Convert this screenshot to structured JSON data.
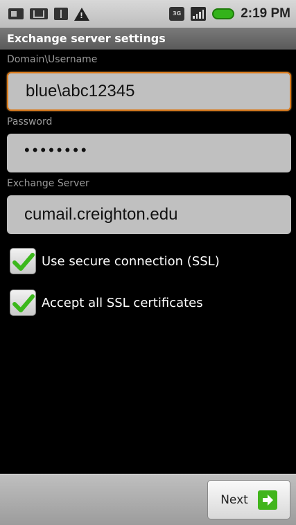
{
  "status_bar": {
    "time": "2:19 PM",
    "network_label": "3G",
    "icons": [
      "sim-icon",
      "mail-icon",
      "usb-icon",
      "warning-icon",
      "network-3g-icon",
      "signal-icon",
      "battery-icon"
    ],
    "battery_color": "#33b31a"
  },
  "title_bar": {
    "title": "Exchange server settings"
  },
  "form": {
    "username": {
      "label": "Domain\\Username",
      "value": "blue\\abc12345"
    },
    "password": {
      "label": "Password",
      "value": "••••••••"
    },
    "server": {
      "label": "Exchange Server",
      "value": "cumail.creighton.edu"
    },
    "ssl": {
      "label": "Use secure connection (SSL)",
      "checked": true
    },
    "accept_certs": {
      "label": "Accept all SSL certificates",
      "checked": true
    }
  },
  "bottom_bar": {
    "next_label": "Next"
  },
  "colors": {
    "focus_border": "#d97a1c",
    "check_green": "#3cb81c",
    "title_bar": "#6a6a6a"
  }
}
